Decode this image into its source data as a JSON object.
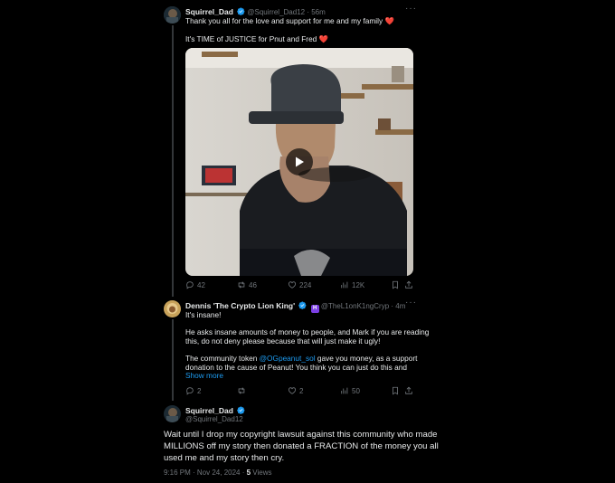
{
  "tweet1": {
    "display_name": "Squirrel_Dad",
    "handle": "@Squirrel_Dad12",
    "separator": "·",
    "time": "56m",
    "line1": "Thank you all for the love and support for me and my family",
    "line2": "It's TIME of JUSTICE for Pnut and Fred",
    "heart_emoji": "❤️",
    "replies": "42",
    "reposts": "46",
    "likes": "224",
    "views": "12K"
  },
  "tweet2": {
    "display_name": "Dennis 'The Crypto Lion King'",
    "handle": "@TheL1onK1ngCryp",
    "badge_letter": "H",
    "separator": "·",
    "time": "4m",
    "p1": "It's insane!",
    "p2_line1": "He asks insane amounts of money to people, and Mark if you are reading",
    "p2_line2": "this, do not deny please because that will just make it ugly!",
    "p3_line1_pre": "The community token ",
    "p3_mention": "@OGpeanut_sol",
    "p3_line1_post": " gave you money, as a support",
    "p3_line2": "donation to the cause of Peanut! You think you can just do this and",
    "show_more": "Show more",
    "replies": "2",
    "likes": "2",
    "views": "50"
  },
  "tweet3": {
    "display_name": "Squirrel_Dad",
    "handle": "@Squirrel_Dad12",
    "line1": "Wait until I drop my copyright lawsuit against this community who made",
    "line2": "MILLIONS off my story then donated a FRACTION of the money you all",
    "line3": "used me and my story then cry.",
    "timestamp": "9:16 PM · Nov 24, 2024 · ",
    "views_count": "5",
    "views_label": " Views"
  },
  "colors": {
    "background": "#000000",
    "text": "#e7e9ea",
    "muted": "#71767b",
    "link": "#1d9bf0",
    "verified": "#1d9bf0",
    "heart": "#f91880"
  },
  "icons": [
    "verified-badge-icon",
    "more-icon",
    "play-icon",
    "reply-icon",
    "repost-icon",
    "like-icon",
    "views-icon",
    "bookmark-icon",
    "share-icon"
  ]
}
